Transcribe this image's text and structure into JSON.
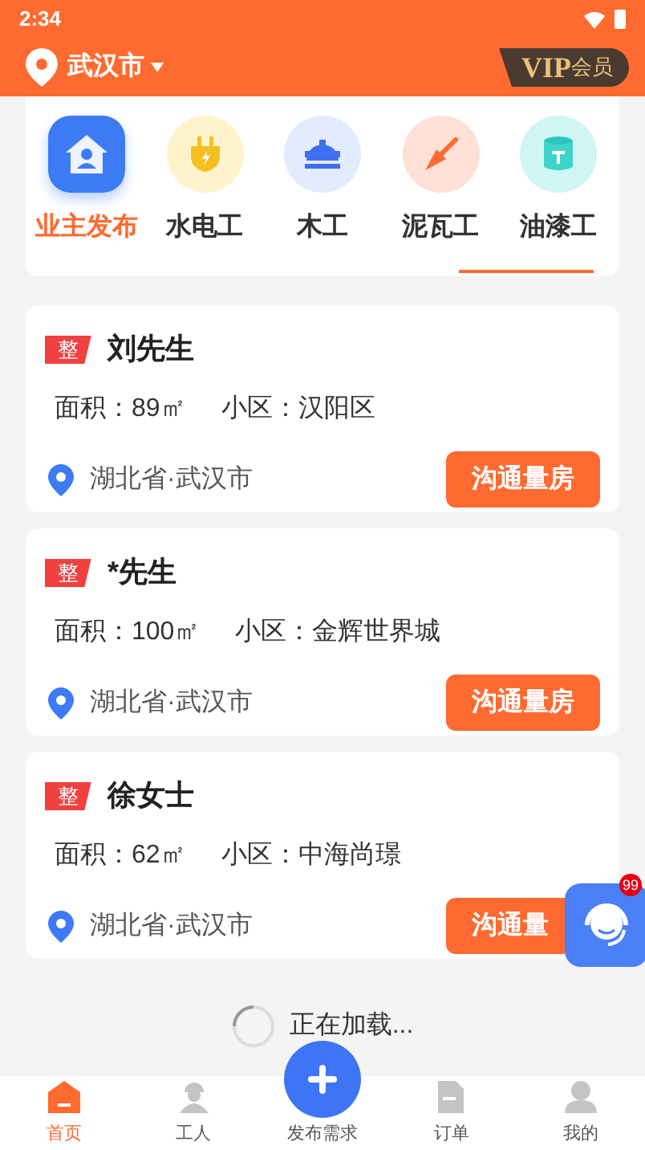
{
  "status_bar": {
    "time": "2:34"
  },
  "header": {
    "city": "武汉市",
    "vip_label": "VIP",
    "vip_suffix": "会员"
  },
  "categories": [
    {
      "label": "业主发布",
      "selected": true,
      "kind": "owner"
    },
    {
      "label": "水电工",
      "selected": false,
      "kind": "electric"
    },
    {
      "label": "木工",
      "selected": false,
      "kind": "carpenter"
    },
    {
      "label": "泥瓦工",
      "selected": false,
      "kind": "mason"
    },
    {
      "label": "油漆工",
      "selected": false,
      "kind": "painter"
    }
  ],
  "listings": [
    {
      "tag": "整",
      "name": "刘先生",
      "area": "面积：89㎡",
      "community": "小区：汉阳区",
      "location": "湖北省·武汉市",
      "action": "沟通量房",
      "covered": false
    },
    {
      "tag": "整",
      "name": "*先生",
      "area": "面积：100㎡",
      "community": "小区：金辉世界城",
      "location": "湖北省·武汉市",
      "action": "沟通量房",
      "covered": false
    },
    {
      "tag": "整",
      "name": "徐女士",
      "area": "面积：62㎡",
      "community": "小区：中海尚璟",
      "location": "湖北省·武汉市",
      "action": "沟通量",
      "covered": true
    }
  ],
  "support": {
    "badge": "99"
  },
  "loading": {
    "text": "正在加载..."
  },
  "tabbar": [
    {
      "label": "首页",
      "selected": true,
      "kind": "home"
    },
    {
      "label": "工人",
      "selected": false,
      "kind": "worker"
    },
    {
      "label": "发布需求",
      "selected": false,
      "kind": "publish"
    },
    {
      "label": "订单",
      "selected": false,
      "kind": "order"
    },
    {
      "label": "我的",
      "selected": false,
      "kind": "me"
    }
  ]
}
